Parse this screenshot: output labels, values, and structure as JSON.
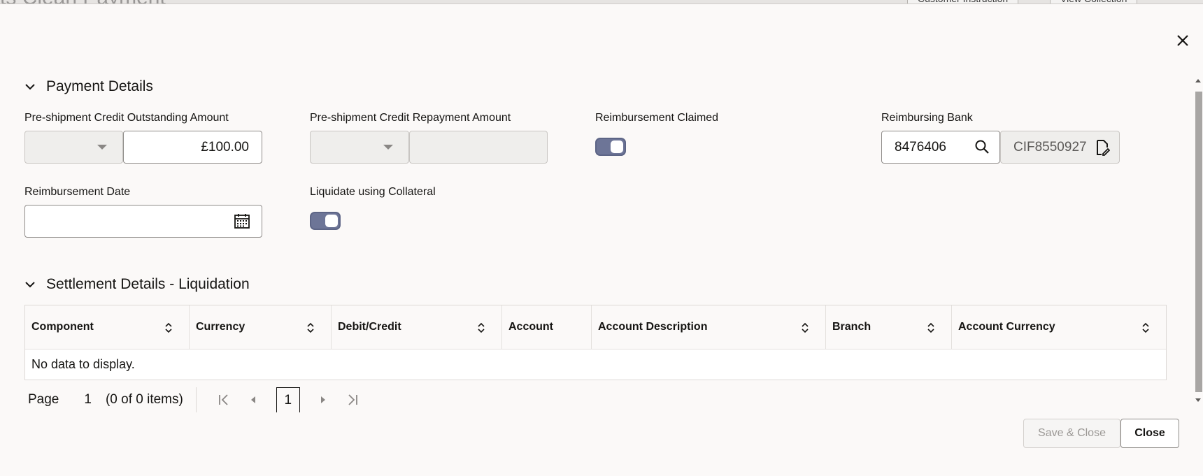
{
  "backdrop": {
    "title": "ts Clean Payment",
    "buttons": [
      "Customer Instruction",
      "View Collection"
    ]
  },
  "dialog": {
    "close_icon": "close-icon"
  },
  "payment_details": {
    "title": "Payment Details",
    "fields": {
      "outstanding_label": "Pre-shipment Credit Outstanding Amount",
      "outstanding_currency": "",
      "outstanding_value": "£100.00",
      "repayment_label": "Pre-shipment Credit Repayment Amount",
      "repayment_currency": "",
      "repayment_value": "",
      "reimb_claimed_label": "Reimbursement Claimed",
      "reimb_claimed_on": true,
      "reimbursing_bank_label": "Reimbursing Bank",
      "reimbursing_bank_value": "8476406",
      "reimbursing_bank_cif": "CIF8550927",
      "reimb_date_label": "Reimbursement Date",
      "reimb_date_value": "",
      "liquidate_label": "Liquidate using Collateral",
      "liquidate_on": true
    }
  },
  "settlement": {
    "title": "Settlement Details - Liquidation",
    "columns": [
      "Component",
      "Currency",
      "Debit/Credit",
      "Account",
      "Account Description",
      "Branch",
      "Account Currency"
    ],
    "empty_text": "No data to display.",
    "pager": {
      "page_label": "Page",
      "page_value": "1",
      "items_text": "(0 of 0 items)",
      "current_page": "1"
    }
  },
  "footer": {
    "save_close_label": "Save & Close",
    "close_label": "Close"
  },
  "colors": {
    "toggle_on": "#6d7597",
    "background": "#fbf9f8"
  }
}
